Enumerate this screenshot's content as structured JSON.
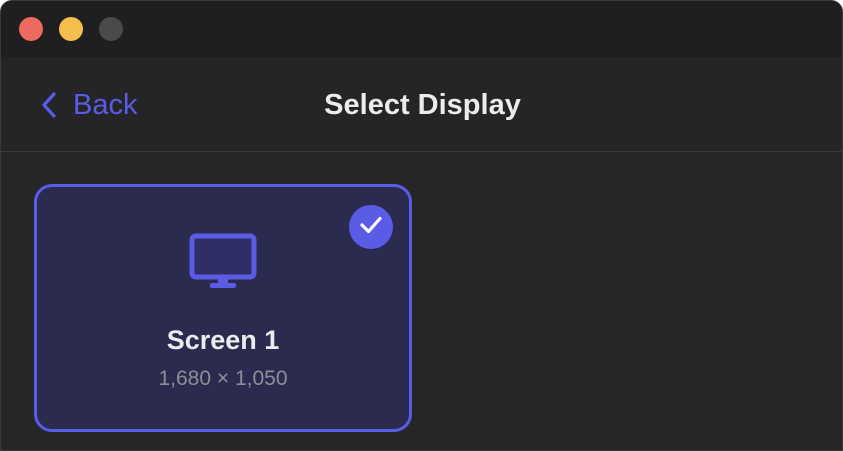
{
  "window": {
    "controls": [
      "close",
      "minimize",
      "maximize"
    ]
  },
  "header": {
    "back_label": "Back",
    "title": "Select Display"
  },
  "displays": [
    {
      "name": "Screen 1",
      "resolution": "1,680 × 1,050",
      "selected": true,
      "icon": "monitor-icon"
    }
  ],
  "colors": {
    "accent": "#5b5ce6",
    "window_bg": "#262628",
    "card_bg": "#2b2a4f"
  }
}
